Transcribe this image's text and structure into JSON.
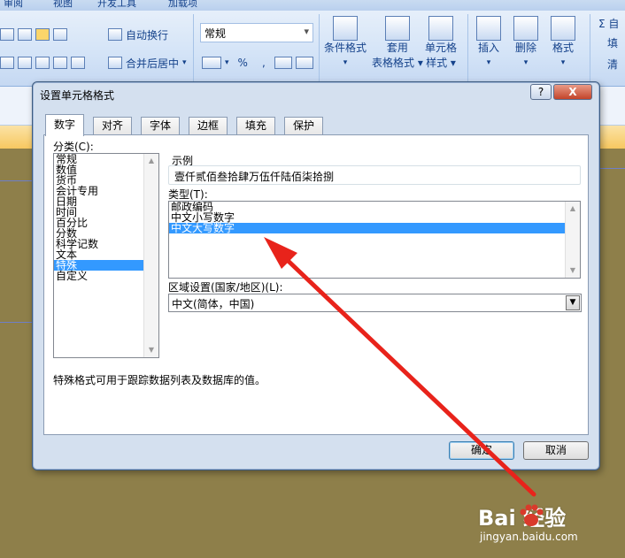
{
  "ribbon": {
    "tabs": [
      "审阅",
      "视图",
      "开发工具",
      "加载项"
    ],
    "wrap_text": "自动换行",
    "merge_center": "合并后居中",
    "number_format": "常规",
    "percent": "%",
    "comma": ",",
    "conditional_format": [
      "条件格式",
      "▾"
    ],
    "table_format": [
      "套用",
      "表格格式 ▾"
    ],
    "cell_style": [
      "单元格",
      "样式 ▾"
    ],
    "insert": [
      "插入",
      "▾"
    ],
    "delete": [
      "删除",
      "▾"
    ],
    "format": [
      "格式",
      "▾"
    ],
    "side_items": [
      "Σ 自",
      "填",
      "清"
    ]
  },
  "dialog": {
    "title": "设置单元格格式",
    "help": "?",
    "close": "X",
    "tabs": [
      "数字",
      "对齐",
      "字体",
      "边框",
      "填充",
      "保护"
    ],
    "active_tab": "数字",
    "category_label": "分类(C):",
    "categories": [
      "常规",
      "数值",
      "货币",
      "会计专用",
      "日期",
      "时间",
      "百分比",
      "分数",
      "科学记数",
      "文本",
      "特殊",
      "自定义"
    ],
    "selected_category": "特殊",
    "sample_label": "示例",
    "sample_value": "壹仟贰佰叁拾肆万伍仟陆佰柒拾捌",
    "type_label": "类型(T):",
    "types": [
      "邮政编码",
      "中文小写数字",
      "中文大写数字"
    ],
    "selected_type": "中文大写数字",
    "locale_label": "区域设置(国家/地区)(L):",
    "locale_value": "中文(简体，中国)",
    "description": "特殊格式可用于跟踪数据列表及数据库的值。",
    "ok": "确定",
    "cancel": "取消"
  },
  "watermark": {
    "logo": "Bai 经验",
    "url": "jingyan.baidu.com"
  },
  "colors": {
    "selection": "#3399ff",
    "arrow": "#e8231b",
    "sheet_bg": "#8e7f4a",
    "dialog_bg": "#d4e0ef"
  }
}
